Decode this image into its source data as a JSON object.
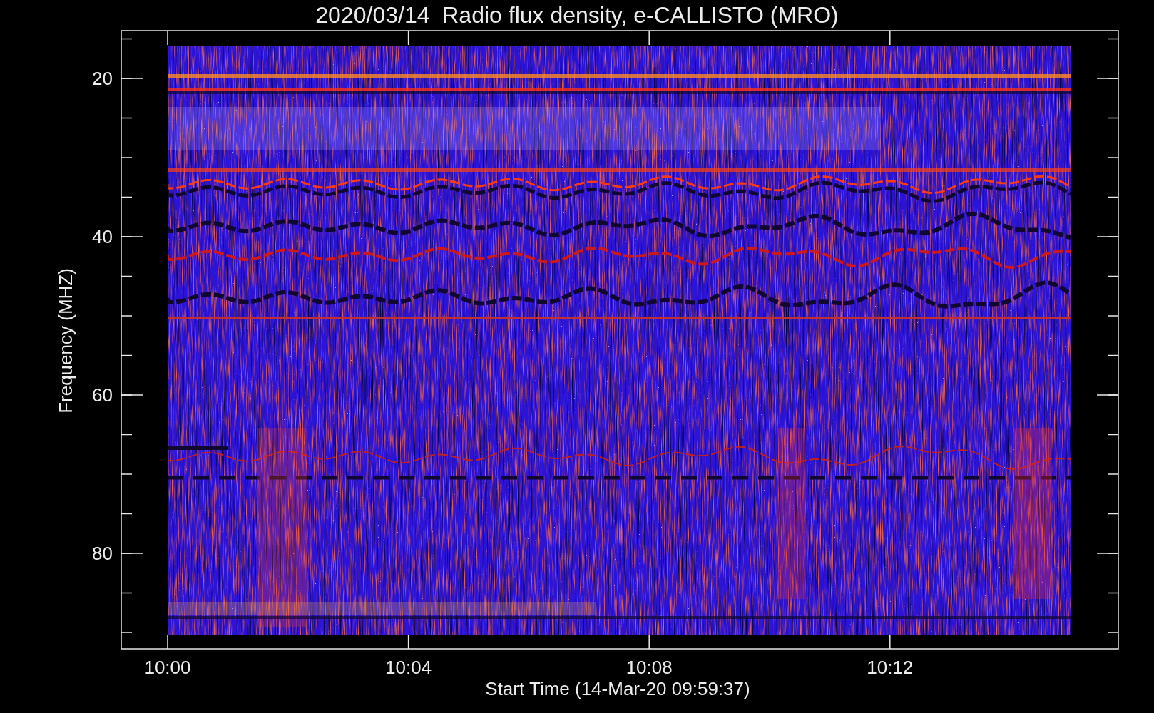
{
  "title": "2020/03/14  Radio flux density, e-CALLISTO (MRO)",
  "y_axis": {
    "label": "Frequency (MHZ)",
    "ticks": [
      "20",
      "40",
      "60",
      "80"
    ]
  },
  "x_axis": {
    "label": "Start Time (14-Mar-20 09:59:37)",
    "ticks": [
      "10:00",
      "10:04",
      "10:08",
      "10:12"
    ]
  }
}
